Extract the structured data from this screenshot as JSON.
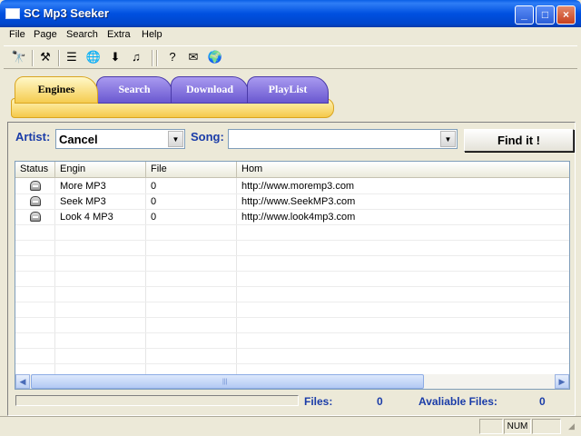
{
  "window": {
    "title": "SC Mp3 Seeker"
  },
  "menu": [
    "File",
    "Page",
    "Search",
    "Extra",
    "Help"
  ],
  "toolbar_icons": [
    "binoculars-icon",
    "tools-icon",
    "list-icon",
    "globe-search-icon",
    "download-icon",
    "music-note-icon",
    "help-icon",
    "mail-icon",
    "globe-icon"
  ],
  "tabs": [
    {
      "label": "Engines",
      "active": true
    },
    {
      "label": "Search",
      "active": false
    },
    {
      "label": "Download",
      "active": false
    },
    {
      "label": "PlayList",
      "active": false
    }
  ],
  "search": {
    "artist_label": "Artist:",
    "artist_value": "Cancel",
    "song_label": "Song:",
    "song_value": "",
    "find_label": "Find it !"
  },
  "table": {
    "columns": [
      "Status",
      "Engin",
      "File",
      "Hom"
    ],
    "rows": [
      {
        "engine": "More MP3",
        "file": "0",
        "home": "http://www.moremp3.com"
      },
      {
        "engine": "Seek MP3",
        "file": "0",
        "home": "http://www.SeekMP3.com"
      },
      {
        "engine": "Look 4 MP3",
        "file": "0",
        "home": "http://www.look4mp3.com"
      }
    ]
  },
  "counts": {
    "files_label": "Files:",
    "files_value": "0",
    "available_label": "Avaliable Files:",
    "available_value": "0"
  },
  "statusbar": {
    "num": "NUM"
  },
  "colors": {
    "title_blue": "#0050e0",
    "label_blue": "#1a3ca8",
    "tab_yellow": "#f5cc50",
    "tab_purple": "#6a58d0"
  }
}
